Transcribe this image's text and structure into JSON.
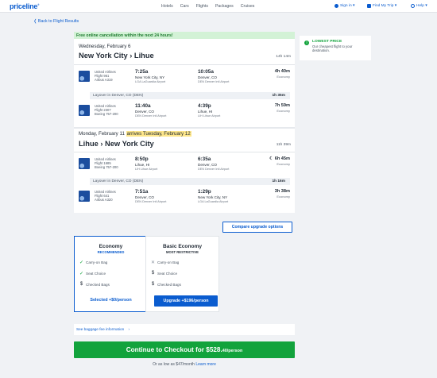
{
  "header": {
    "logo": "priceline",
    "nav": [
      "Hotels",
      "Cars",
      "Flights",
      "Packages",
      "Cruises"
    ],
    "sign_in": "Sign in ▾",
    "find_trip": "Find My Trip ▾",
    "help": "Help ▾"
  },
  "back_link": "❬ Back to Flight Results",
  "promo": "Free online cancellation within the next 24 hours!",
  "side_card": {
    "title": "LOWEST PRICE",
    "desc": "Our cheapest flight to your destination."
  },
  "outbound": {
    "date": "Wednesday, February 6",
    "route": "New York City › Lihue",
    "duration": "14h 14m",
    "segments": [
      {
        "airline": "United Airlines",
        "flight": "Flight 961",
        "aircraft": "Airbus A319",
        "dep_time": "7:25a",
        "dep_city": "New York City, NY",
        "dep_airport": "LGA LaGuardia Airport",
        "arr_time": "10:05a",
        "arr_city": "Denver, CO",
        "arr_airport": "DEN Denver Intl Airport",
        "duration": "4h 40m",
        "cabin": "Economy"
      },
      {
        "airline": "United Airlines",
        "flight": "Flight 2307",
        "aircraft": "Boeing 757-200",
        "dep_time": "11:40a",
        "dep_city": "Denver, CO",
        "dep_airport": "DEN Denver Intl Airport",
        "arr_time": "4:39p",
        "arr_city": "Lihue, HI",
        "arr_airport": "LIH Lihue Airport",
        "duration": "7h 59m",
        "cabin": "Economy"
      }
    ],
    "layover": {
      "text": "Layover in Denver, CO (DEN)",
      "duration": "1h 35m"
    }
  },
  "return": {
    "date": "Monday, February 11",
    "arrives_note": "arrives Tuesday, February 12",
    "route": "Lihue › New York City",
    "duration": "11h 39m",
    "segments": [
      {
        "airline": "United Airlines",
        "flight": "Flight 1685",
        "aircraft": "Boeing 757-200",
        "dep_time": "8:50p",
        "dep_city": "Lihue, HI",
        "dep_airport": "LIH Lihue Airport",
        "arr_time": "6:35a",
        "arr_city": "Denver, CO",
        "arr_airport": "DEN Denver Intl Airport",
        "duration": "☾ 6h 45m",
        "cabin": "Economy"
      },
      {
        "airline": "United Airlines",
        "flight": "Flight 641",
        "aircraft": "Airbus A320",
        "dep_time": "7:51a",
        "dep_city": "Denver, CO",
        "dep_airport": "DEN Denver Intl Airport",
        "arr_time": "1:29p",
        "arr_city": "New York City, NY",
        "arr_airport": "LGA LaGuardia Airport",
        "duration": "3h 38m",
        "cabin": "Economy"
      }
    ],
    "layover": {
      "text": "Layover in Denver, CO (DEN)",
      "duration": "1h 16m"
    }
  },
  "compare_button": "Compare upgrade options",
  "fares": {
    "economy": {
      "title": "Economy",
      "subtitle": "RECOMMENDED",
      "features": [
        "Carry-on Bag",
        "Seat Choice",
        "Checked Bags"
      ],
      "selected_label": "Selected +$0/person"
    },
    "basic": {
      "title": "Basic Economy",
      "subtitle": "MOST RESTRICTIVE",
      "features": [
        "Carry-on Bag",
        "Seat Choice",
        "Checked Bags"
      ],
      "upgrade_label": "Upgrade +$196/person"
    }
  },
  "baggage_link": "See baggage fee information",
  "checkout": {
    "label": "Continue to Checkout for $528.",
    "cents": "40/person"
  },
  "affirm": {
    "text": "Or as low as $47/month",
    "link": "Learn more"
  },
  "colors": {
    "brand": "#0a5ccf",
    "cta": "#12a33c",
    "promo_bg": "#d3f2d6"
  }
}
